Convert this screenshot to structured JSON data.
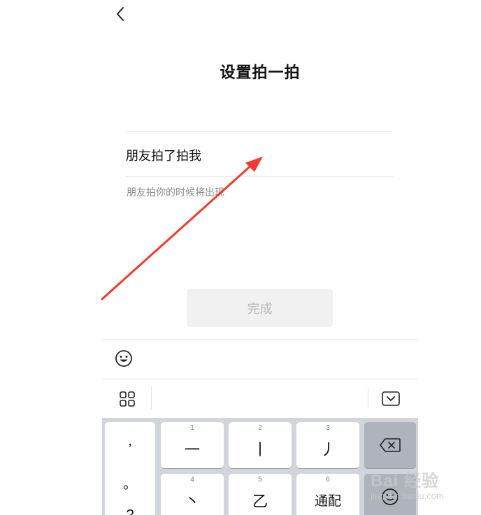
{
  "header": {
    "title": "设置拍一拍"
  },
  "pat": {
    "input_value": "朋友拍了拍我",
    "hint": "朋友拍你的时候将出现"
  },
  "actions": {
    "done_label": "完成"
  },
  "keyboard": {
    "punctuation": [
      ",",
      "。",
      "?"
    ],
    "keys": [
      {
        "num": "1",
        "glyph": "一"
      },
      {
        "num": "2",
        "glyph": "丨"
      },
      {
        "num": "3",
        "glyph": "丿"
      },
      {
        "num": "4",
        "glyph": "丶"
      },
      {
        "num": "5",
        "glyph": "乙"
      },
      {
        "num": "6",
        "glyph": "通配"
      }
    ]
  },
  "icons": {
    "back": "chevron-left-icon",
    "emoji": "smiley-icon",
    "grid": "grid-icon",
    "collapse": "keyboard-collapse-icon",
    "backspace": "backspace-icon"
  },
  "watermark": {
    "main": "Bai 经验",
    "sub": "jingyan.baidu.com"
  },
  "colors": {
    "arrow": "#f03a2e",
    "keyboard_bg": "#d2d5db",
    "button_disabled_bg": "#f1f1f1",
    "button_disabled_text": "#b8b8b8"
  }
}
